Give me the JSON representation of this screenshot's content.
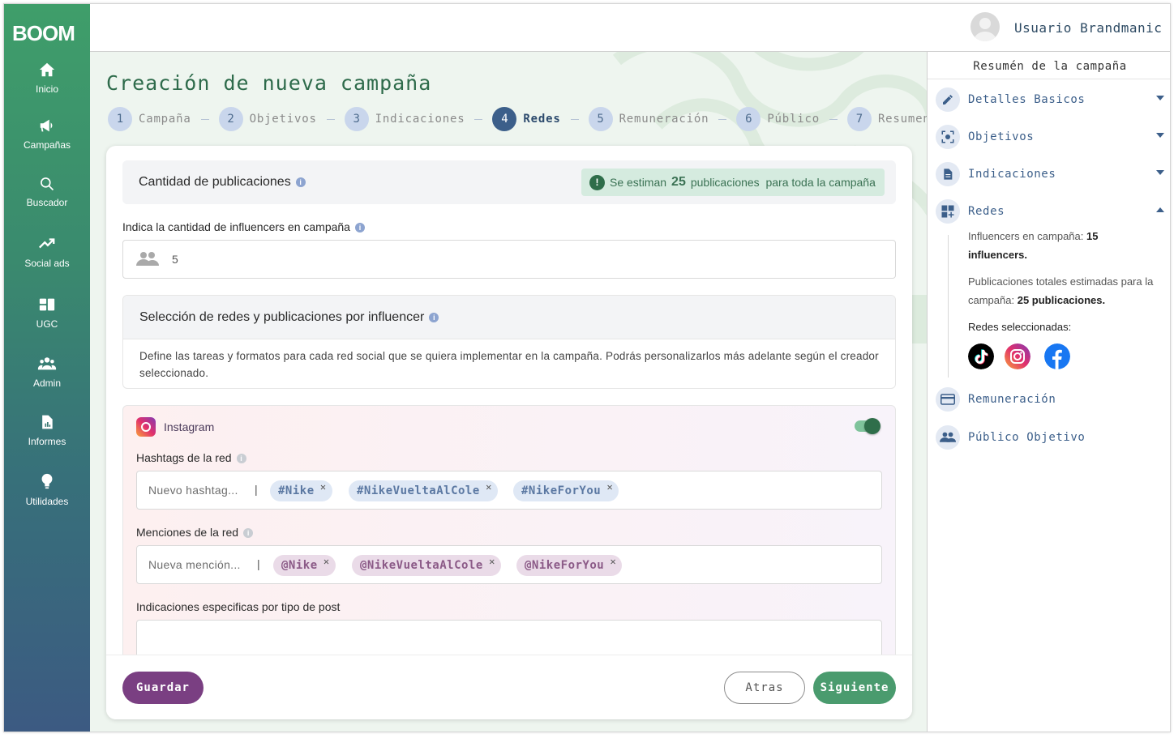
{
  "brand": {
    "logo_text": "BOOM"
  },
  "sidebar": {
    "items": [
      {
        "label": "Inicio",
        "icon": "home-icon"
      },
      {
        "label": "Campañas",
        "icon": "megaphone-icon"
      },
      {
        "label": "Buscador",
        "icon": "search-icon"
      },
      {
        "label": "Social ads",
        "icon": "trending-up-icon"
      },
      {
        "label": "UGC",
        "icon": "dashboard-icon"
      },
      {
        "label": "Admin",
        "icon": "group-icon"
      },
      {
        "label": "Informes",
        "icon": "report-icon"
      },
      {
        "label": "Utilidades",
        "icon": "lightbulb-icon"
      }
    ]
  },
  "header": {
    "username": "Usuario Brandmanic"
  },
  "page": {
    "title": "Creación de nueva campaña"
  },
  "stepper": {
    "steps": [
      {
        "num": "1",
        "label": "Campaña"
      },
      {
        "num": "2",
        "label": "Objetivos"
      },
      {
        "num": "3",
        "label": "Indicaciones"
      },
      {
        "num": "4",
        "label": "Redes",
        "active": true
      },
      {
        "num": "5",
        "label": "Remuneración"
      },
      {
        "num": "6",
        "label": "Público"
      },
      {
        "num": "7",
        "label": "Resumen"
      }
    ]
  },
  "publications": {
    "title": "Cantidad de publicaciones",
    "estimate_prefix": "Se estiman",
    "estimate_count": "25",
    "estimate_suffix": "publicaciones  para toda la campaña",
    "influencers_label": "Indica la cantidad de influencers en campaña",
    "influencers_value": "5"
  },
  "networks": {
    "title": "Selección de redes y publicaciones por influencer",
    "description": "Define las tareas y formatos para cada red social que se quiera implementar en la campaña. Podrás personalizarlos más adelante según el creador seleccionado.",
    "instagram": {
      "name": "Instagram",
      "enabled": true,
      "hashtags_label": "Hashtags de la red",
      "hashtag_placeholder": "Nuevo hashtag...",
      "hashtags": [
        "#Nike",
        "#NikeVueltaAlCole",
        "#NikeForYou"
      ],
      "mentions_label": "Menciones de la red",
      "mention_placeholder": "Nueva mención...",
      "mentions": [
        "@Nike",
        "@NikeVueltaAlCole",
        "@NikeForYou"
      ],
      "specific_label": "Indicaciones especificas por tipo de post"
    }
  },
  "footer": {
    "save": "Guardar",
    "back": "Atras",
    "next": "Siguiente"
  },
  "summary": {
    "title": "Resumén de la campaña",
    "items": [
      {
        "label": "Detalles Basicos",
        "icon": "pencil-icon"
      },
      {
        "label": "Objetivos",
        "icon": "target-icon"
      },
      {
        "label": "Indicaciones",
        "icon": "document-icon"
      },
      {
        "label": "Redes",
        "icon": "grid-add-icon"
      },
      {
        "label": "Remuneración",
        "icon": "credit-card-icon"
      },
      {
        "label": "Público Objetivo",
        "icon": "people-icon"
      }
    ],
    "redes_detail": {
      "influencers_prefix": "Influencers en campaña:",
      "influencers_value": "15 influencers.",
      "pubs_prefix": "Publicaciones totales estimadas para la campaña:",
      "pubs_value": "25 publicaciones.",
      "selected_label": "Redes seleccionadas:",
      "networks": [
        "tiktok",
        "instagram",
        "facebook"
      ]
    }
  },
  "colors": {
    "primary_green": "#4a9b6e",
    "accent_purple": "#7a3f82",
    "accent_blue": "#3c5f8a"
  }
}
